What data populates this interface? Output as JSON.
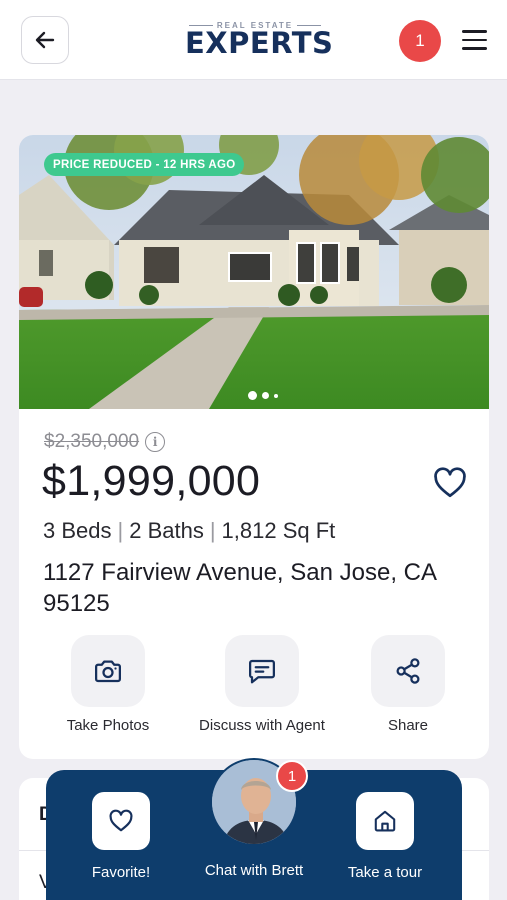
{
  "header": {
    "back_icon": "arrow-left-icon",
    "logo_small": "REAL ESTATE",
    "logo_big": "EXPERTS",
    "notification_count": "1",
    "menu_icon": "hamburger-menu-icon"
  },
  "listing": {
    "tag": "PRICE REDUCED - 12 HRS AGO",
    "photo_dots": 3,
    "old_price": "$2,350,000",
    "price": "$1,999,000",
    "beds": "3 Beds",
    "baths": "2 Baths",
    "sqft": "1,812 Sq Ft",
    "address": "1127 Fairview Avenue, San Jose, CA 95125",
    "actions": [
      {
        "label": "Take Photos",
        "icon": "camera-icon"
      },
      {
        "label": "Discuss with Agent",
        "icon": "chat-icon"
      },
      {
        "label": "Share",
        "icon": "share-icon"
      }
    ]
  },
  "next_card": {
    "heading_partial": "D",
    "text_partial": "V"
  },
  "bottom_bar": {
    "favorite_label": "Favorite!",
    "chat_label": "Chat with Brett",
    "chat_badge": "1",
    "tour_label": "Take a tour"
  },
  "colors": {
    "brand_navy": "#0e3d6c",
    "badge_red": "#e94848",
    "tag_green": "#3ec98f"
  }
}
